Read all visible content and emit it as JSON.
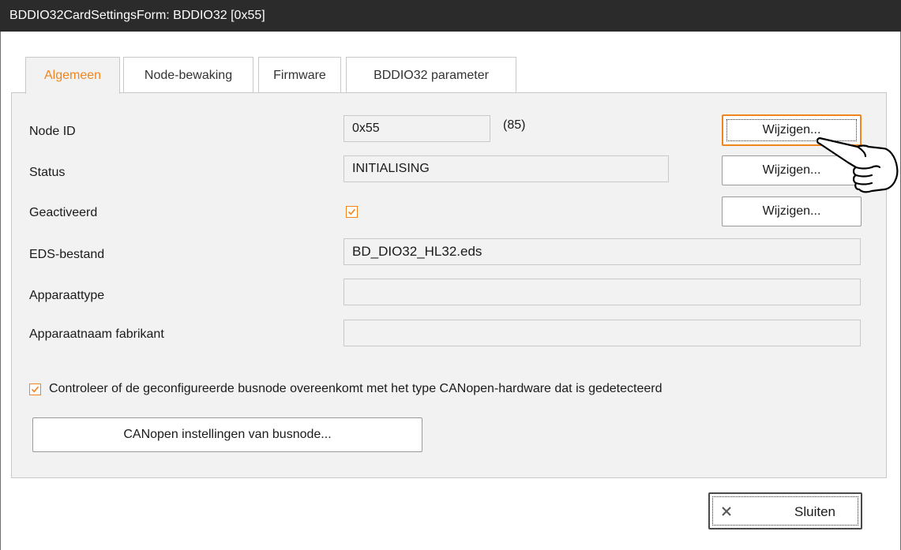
{
  "window": {
    "title": "BDDIO32CardSettingsForm: BDDIO32 [0x55]"
  },
  "tabs": [
    {
      "label": "Algemeen",
      "active": true
    },
    {
      "label": "Node-bewaking",
      "active": false
    },
    {
      "label": "Firmware",
      "active": false
    },
    {
      "label": "BDDIO32 parameter",
      "active": false
    }
  ],
  "fields": {
    "node_id": {
      "label": "Node ID",
      "value": "0x55",
      "decimal": "(85)"
    },
    "status": {
      "label": "Status",
      "value": "INITIALISING"
    },
    "activated": {
      "label": "Geactiveerd",
      "checked": true
    },
    "eds_file": {
      "label": "EDS-bestand",
      "value": "BD_DIO32_HL32.eds"
    },
    "device_type": {
      "label": "Apparaattype",
      "value": ""
    },
    "manufacturer_device_name": {
      "label": "Apparaatnaam fabrikant",
      "value": ""
    }
  },
  "buttons": {
    "change_label": "Wijzigen...",
    "canopen_settings": "CANopen instellingen van busnode...",
    "close": "Sluiten"
  },
  "check_hardware": {
    "checked": true,
    "label": "Controleer of de geconfigureerde busnode overeenkomt met het type CANopen-hardware dat is gedetecteerd"
  },
  "colors": {
    "accent": "#f0851e",
    "titlebar": "#2b2b2b",
    "panel": "#f2f2f2"
  },
  "icons": {
    "close": "close-x-icon",
    "cursor": "hand-pointer-icon"
  }
}
